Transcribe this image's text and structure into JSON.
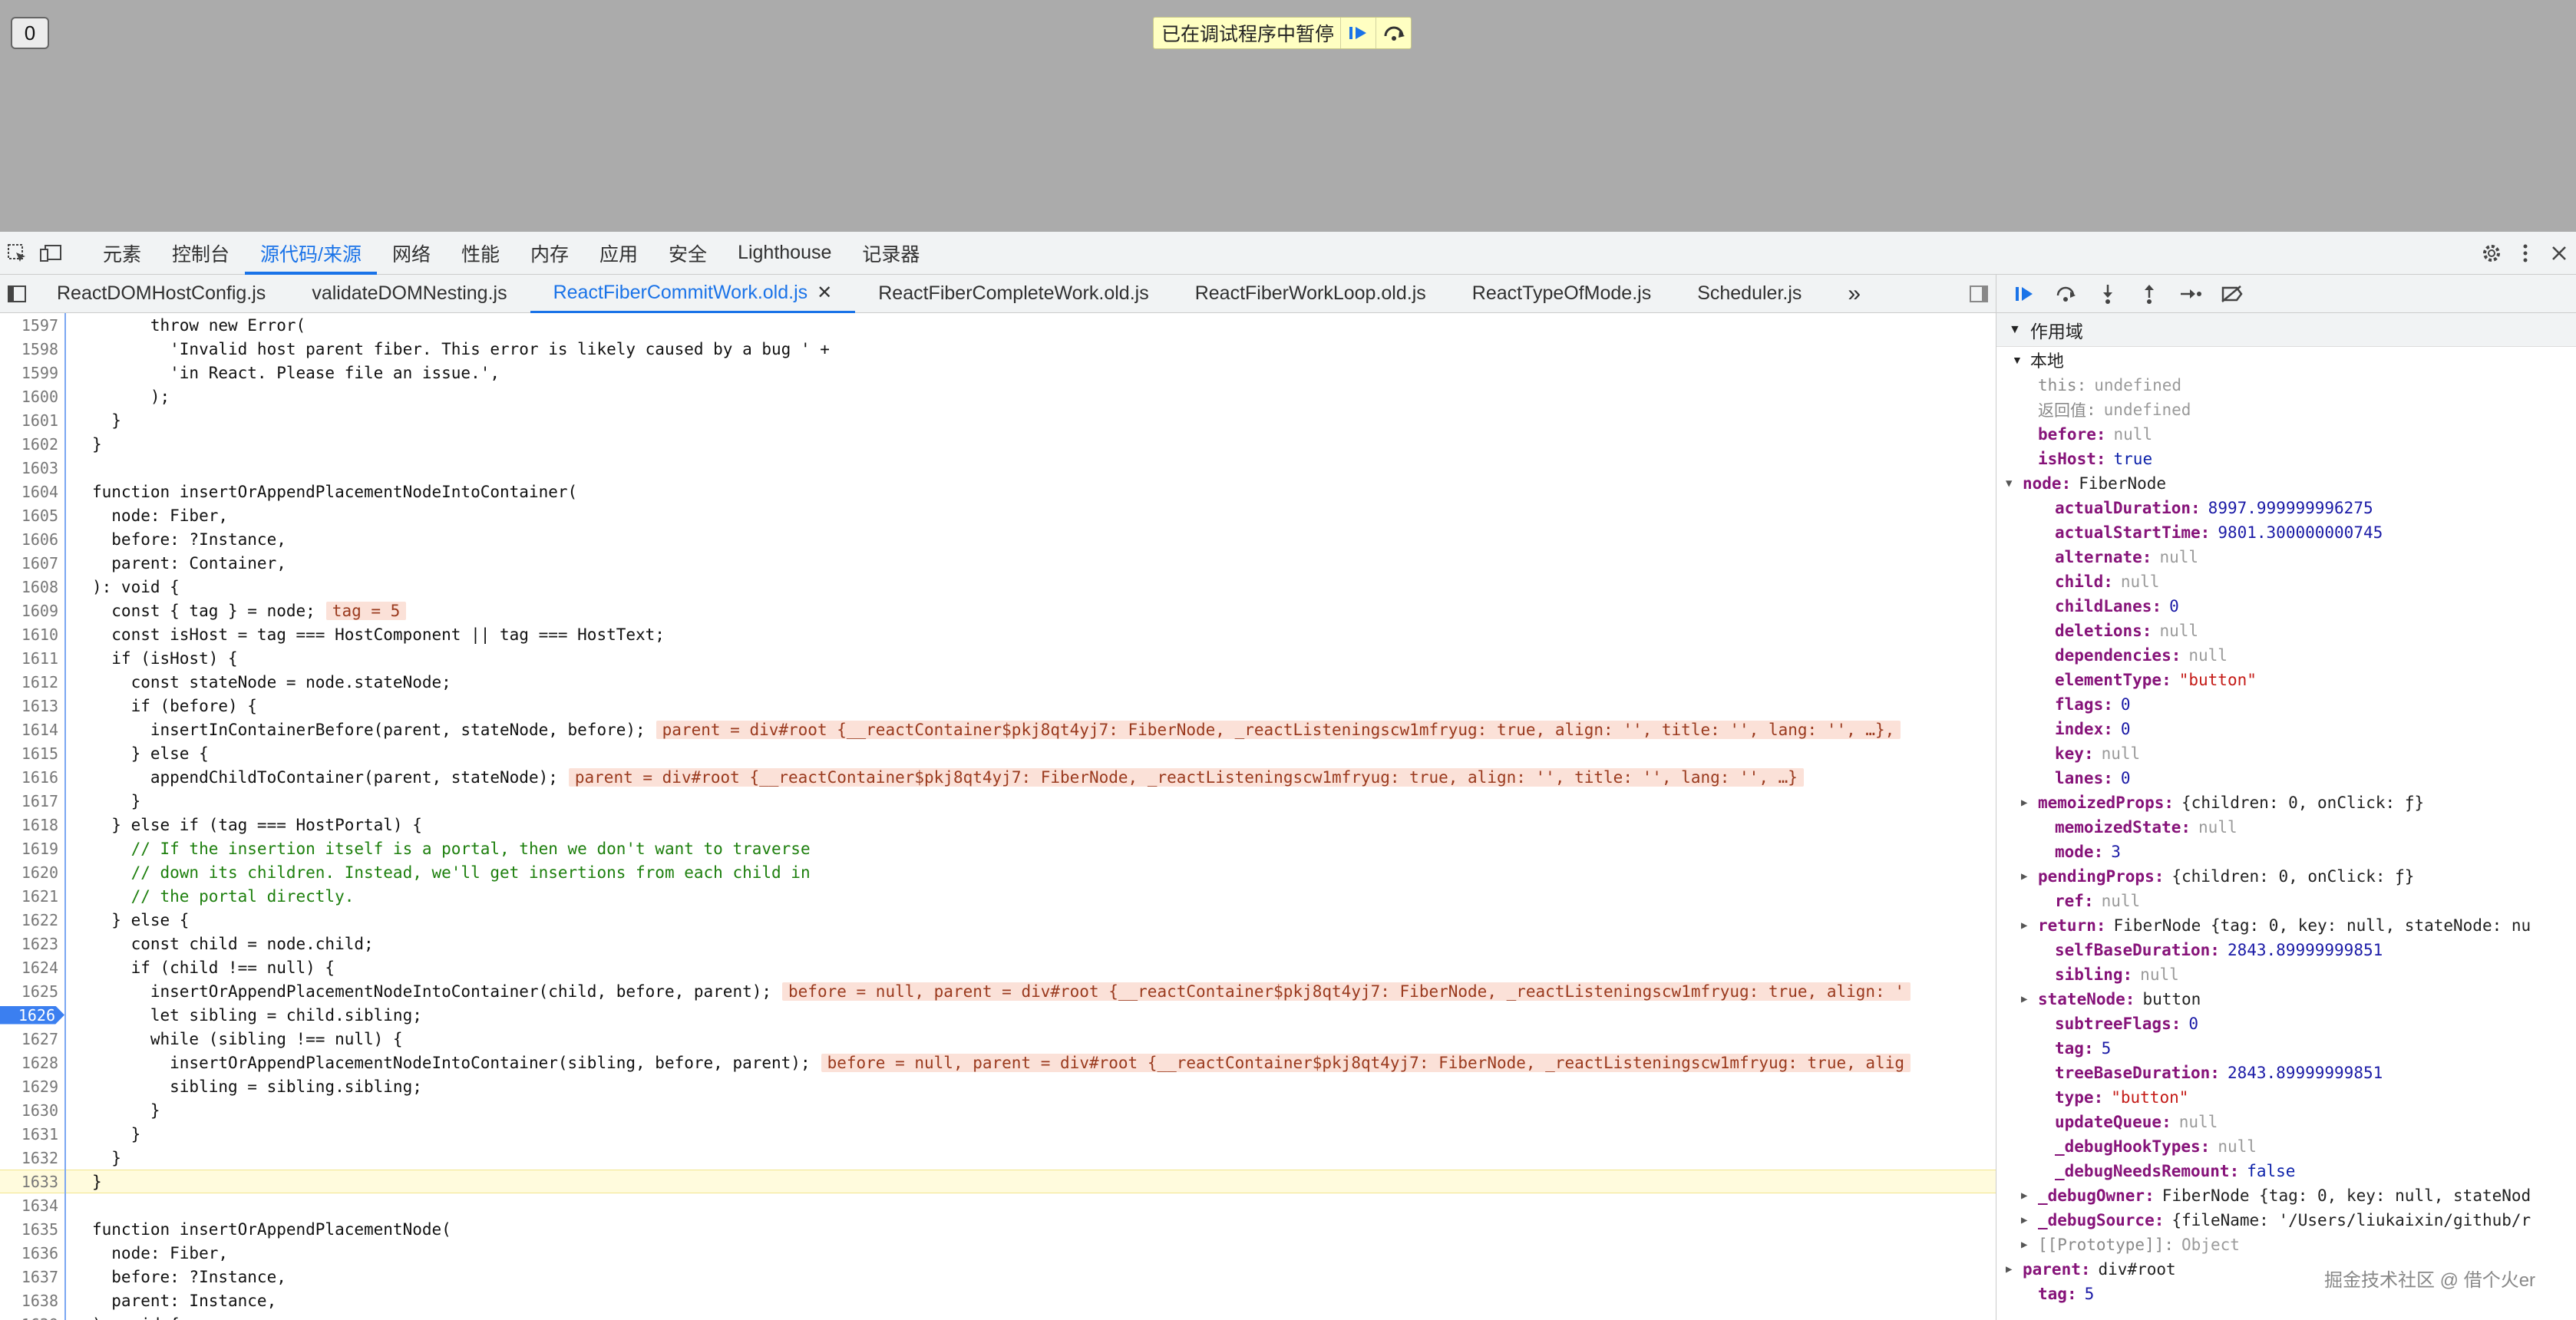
{
  "page": {
    "count_button": "0"
  },
  "banner": {
    "text": "已在调试程序中暂停",
    "resume_icon": "resume-icon",
    "step_icon": "step-over-icon"
  },
  "devtools_tabs": [
    "元素",
    "控制台",
    "源代码/来源",
    "网络",
    "性能",
    "内存",
    "应用",
    "安全",
    "Lighthouse",
    "记录器"
  ],
  "active_devtools_tab": "源代码/来源",
  "file_tabs": [
    "ReactDOMHostConfig.js",
    "validateDOMNesting.js",
    "ReactFiberCommitWork.old.js",
    "ReactFiberCompleteWork.old.js",
    "ReactFiberWorkLoop.old.js",
    "ReactTypeOfMode.js",
    "Scheduler.js"
  ],
  "active_file_tab": "ReactFiberCommitWork.old.js",
  "more_tabs": "»",
  "code_lines": [
    {
      "n": "1597",
      "t": "      throw new Error("
    },
    {
      "n": "1598",
      "t": "        'Invalid host parent fiber. This error is likely caused by a bug ' +"
    },
    {
      "n": "1599",
      "t": "        'in React. Please file an issue.',"
    },
    {
      "n": "1600",
      "t": "      );"
    },
    {
      "n": "1601",
      "t": "  }"
    },
    {
      "n": "1602",
      "t": "}"
    },
    {
      "n": "1603",
      "t": ""
    },
    {
      "n": "1604",
      "t": "function insertOrAppendPlacementNodeIntoContainer("
    },
    {
      "n": "1605",
      "t": "  node: Fiber,"
    },
    {
      "n": "1606",
      "t": "  before: ?Instance,"
    },
    {
      "n": "1607",
      "t": "  parent: Container,"
    },
    {
      "n": "1608",
      "t": "): void {"
    },
    {
      "n": "1609",
      "t": "  const { tag } = node;",
      "v": "tag = 5"
    },
    {
      "n": "1610",
      "t": "  const isHost = tag === HostComponent || tag === HostText;"
    },
    {
      "n": "1611",
      "t": "  if (isHost) {"
    },
    {
      "n": "1612",
      "t": "    const stateNode = node.stateNode;"
    },
    {
      "n": "1613",
      "t": "    if (before) {"
    },
    {
      "n": "1614",
      "t": "      insertInContainerBefore(parent, stateNode, before);",
      "v": "parent = div#root {__reactContainer$pkj8qt4yj7: FiberNode, _reactListeningscw1mfryug: true, align: '', title: '', lang: '', …},"
    },
    {
      "n": "1615",
      "t": "    } else {"
    },
    {
      "n": "1616",
      "t": "      appendChildToContainer(parent, stateNode);",
      "v": "parent = div#root {__reactContainer$pkj8qt4yj7: FiberNode, _reactListeningscw1mfryug: true, align: '', title: '', lang: '', …}"
    },
    {
      "n": "1617",
      "t": "    }"
    },
    {
      "n": "1618",
      "t": "  } else if (tag === HostPortal) {"
    },
    {
      "n": "1619",
      "t": "    // If the insertion itself is a portal, then we don't want to traverse",
      "c": true
    },
    {
      "n": "1620",
      "t": "    // down its children. Instead, we'll get insertions from each child in",
      "c": true
    },
    {
      "n": "1621",
      "t": "    // the portal directly.",
      "c": true
    },
    {
      "n": "1622",
      "t": "  } else {"
    },
    {
      "n": "1623",
      "t": "    const child = node.child;"
    },
    {
      "n": "1624",
      "t": "    if (child !== null) {"
    },
    {
      "n": "1625",
      "t": "      insertOrAppendPlacementNodeIntoContainer(child, before, parent);",
      "v": "before = null, parent = div#root {__reactContainer$pkj8qt4yj7: FiberNode, _reactListeningscw1mfryug: true, align: '"
    },
    {
      "n": "1626",
      "t": "      let sibling = child.sibling;",
      "bp": true
    },
    {
      "n": "1627",
      "t": "      while (sibling !== null) {"
    },
    {
      "n": "1628",
      "t": "        insertOrAppendPlacementNodeIntoContainer(sibling, before, parent);",
      "v": "before = null, parent = div#root {__reactContainer$pkj8qt4yj7: FiberNode, _reactListeningscw1mfryug: true, alig"
    },
    {
      "n": "1629",
      "t": "        sibling = sibling.sibling;"
    },
    {
      "n": "1630",
      "t": "      }"
    },
    {
      "n": "1631",
      "t": "    }"
    },
    {
      "n": "1632",
      "t": "  }"
    },
    {
      "n": "1633",
      "t": "}",
      "cur": true
    },
    {
      "n": "1634",
      "t": ""
    },
    {
      "n": "1635",
      "t": "function insertOrAppendPlacementNode("
    },
    {
      "n": "1636",
      "t": "  node: Fiber,"
    },
    {
      "n": "1637",
      "t": "  before: ?Instance,"
    },
    {
      "n": "1638",
      "t": "  parent: Instance,"
    },
    {
      "n": "1639",
      "t": "): void {"
    }
  ],
  "scope": {
    "header": "作用域",
    "local_label": "本地",
    "props": [
      {
        "k": "this",
        "v": "undefined",
        "t": "nul",
        "d": 1,
        "dim": true
      },
      {
        "k": "返回值",
        "v": "undefined",
        "t": "nul",
        "d": 1,
        "dim": true
      },
      {
        "k": "before",
        "v": "null",
        "t": "nul",
        "d": 1
      },
      {
        "k": "isHost",
        "v": "true",
        "t": "kw",
        "d": 1
      },
      {
        "k": "node",
        "v": "FiberNode",
        "t": "obj",
        "d": 0,
        "exp": "down"
      },
      {
        "k": "actualDuration",
        "v": "8997.999999996275",
        "t": "num",
        "d": 2
      },
      {
        "k": "actualStartTime",
        "v": "9801.300000000745",
        "t": "num",
        "d": 2
      },
      {
        "k": "alternate",
        "v": "null",
        "t": "nul",
        "d": 2
      },
      {
        "k": "child",
        "v": "null",
        "t": "nul",
        "d": 2
      },
      {
        "k": "childLanes",
        "v": "0",
        "t": "num",
        "d": 2
      },
      {
        "k": "deletions",
        "v": "null",
        "t": "nul",
        "d": 2
      },
      {
        "k": "dependencies",
        "v": "null",
        "t": "nul",
        "d": 2
      },
      {
        "k": "elementType",
        "v": "\"button\"",
        "t": "str",
        "d": 2
      },
      {
        "k": "flags",
        "v": "0",
        "t": "num",
        "d": 2
      },
      {
        "k": "index",
        "v": "0",
        "t": "num",
        "d": 2
      },
      {
        "k": "key",
        "v": "null",
        "t": "nul",
        "d": 2
      },
      {
        "k": "lanes",
        "v": "0",
        "t": "num",
        "d": 2
      },
      {
        "k": "memoizedProps",
        "v": "{children: 0, onClick: ƒ}",
        "t": "obj",
        "d": 1,
        "exp": "right"
      },
      {
        "k": "memoizedState",
        "v": "null",
        "t": "nul",
        "d": 2
      },
      {
        "k": "mode",
        "v": "3",
        "t": "num",
        "d": 2
      },
      {
        "k": "pendingProps",
        "v": "{children: 0, onClick: ƒ}",
        "t": "obj",
        "d": 1,
        "exp": "right"
      },
      {
        "k": "ref",
        "v": "null",
        "t": "nul",
        "d": 2
      },
      {
        "k": "return",
        "v": "FiberNode {tag: 0, key: null, stateNode: nu",
        "t": "obj",
        "d": 1,
        "exp": "right"
      },
      {
        "k": "selfBaseDuration",
        "v": "2843.89999999851",
        "t": "num",
        "d": 2
      },
      {
        "k": "sibling",
        "v": "null",
        "t": "nul",
        "d": 2
      },
      {
        "k": "stateNode",
        "v": "button",
        "t": "obj",
        "d": 1,
        "exp": "right"
      },
      {
        "k": "subtreeFlags",
        "v": "0",
        "t": "num",
        "d": 2
      },
      {
        "k": "tag",
        "v": "5",
        "t": "num",
        "d": 2
      },
      {
        "k": "treeBaseDuration",
        "v": "2843.89999999851",
        "t": "num",
        "d": 2
      },
      {
        "k": "type",
        "v": "\"button\"",
        "t": "str",
        "d": 2
      },
      {
        "k": "updateQueue",
        "v": "null",
        "t": "nul",
        "d": 2
      },
      {
        "k": "_debugHookTypes",
        "v": "null",
        "t": "nul",
        "d": 2
      },
      {
        "k": "_debugNeedsRemount",
        "v": "false",
        "t": "kw",
        "d": 2
      },
      {
        "k": "_debugOwner",
        "v": "FiberNode {tag: 0, key: null, stateNod",
        "t": "obj",
        "d": 1,
        "exp": "right"
      },
      {
        "k": "_debugSource",
        "v": "{fileName: '/Users/liukaixin/github/r",
        "t": "obj",
        "d": 1,
        "exp": "right"
      },
      {
        "k": "[[Prototype]]",
        "v": "Object",
        "t": "obj",
        "d": 1,
        "exp": "right",
        "dim": true
      },
      {
        "k": "parent",
        "v": "div#root",
        "t": "obj",
        "d": 0,
        "exp": "right"
      },
      {
        "k": "tag",
        "v": "5",
        "t": "num",
        "d": 1
      }
    ]
  },
  "watermark": "掘金技术社区 @ 借个火er"
}
